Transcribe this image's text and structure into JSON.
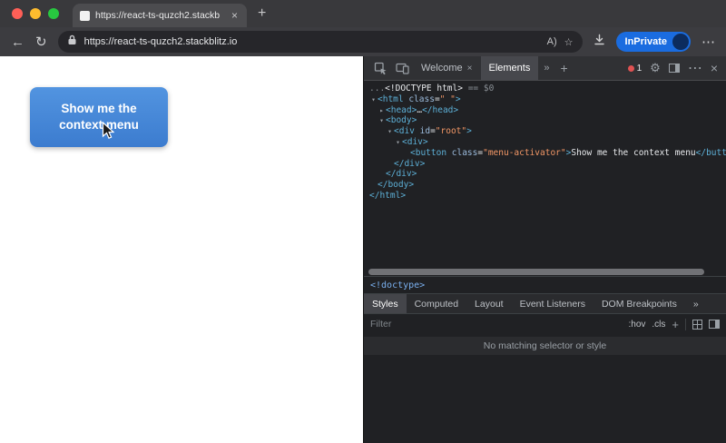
{
  "icons": {
    "back": "←",
    "refresh": "↻",
    "read_aloud": "A)",
    "favorites": "☆",
    "more": "⋯",
    "gear": "⚙",
    "close": "×",
    "chevrons": "»",
    "plus": "+"
  },
  "tabbar": {
    "tab_title": "https://react-ts-quzch2.stackb",
    "tab_close": "×",
    "new_tab": "+"
  },
  "navbar": {
    "url": "https://react-ts-quzch2.stackblitz.io",
    "inprivate": "InPrivate"
  },
  "page": {
    "button_label": "Show me the context menu"
  },
  "devtools": {
    "toolbar": {
      "tab_welcome": "Welcome",
      "tab_elements": "Elements",
      "issues_count": "1"
    },
    "tree": [
      {
        "i": 0,
        "tk": [
          {
            "c": "g",
            "v": "..."
          },
          {
            "c": "p",
            "v": "<!DOCTYPE html>"
          },
          {
            "c": "g",
            "v": " == $0"
          }
        ]
      },
      {
        "i": 0,
        "a": "d",
        "tk": [
          {
            "c": "t",
            "v": "<html"
          },
          {
            "c": "a",
            "v": " class"
          },
          {
            "c": "p",
            "v": "="
          },
          {
            "c": "s",
            "v": "\" \""
          },
          {
            "c": "t",
            "v": ">"
          }
        ]
      },
      {
        "i": 1,
        "a": "r",
        "tk": [
          {
            "c": "t",
            "v": "<head>"
          },
          {
            "c": "p",
            "v": "…"
          },
          {
            "c": "t",
            "v": "</head>"
          }
        ]
      },
      {
        "i": 1,
        "a": "d",
        "tk": [
          {
            "c": "t",
            "v": "<body>"
          }
        ]
      },
      {
        "i": 2,
        "a": "d",
        "tk": [
          {
            "c": "t",
            "v": "<div"
          },
          {
            "c": "a",
            "v": " id"
          },
          {
            "c": "p",
            "v": "="
          },
          {
            "c": "s",
            "v": "\"root\""
          },
          {
            "c": "t",
            "v": ">"
          }
        ]
      },
      {
        "i": 3,
        "a": "d",
        "tk": [
          {
            "c": "t",
            "v": "<div>"
          }
        ]
      },
      {
        "i": 4,
        "a": "s",
        "tk": [
          {
            "c": "t",
            "v": "<button"
          },
          {
            "c": "a",
            "v": " class"
          },
          {
            "c": "p",
            "v": "="
          },
          {
            "c": "s",
            "v": "\"menu-activator\""
          },
          {
            "c": "t",
            "v": ">"
          },
          {
            "c": "p",
            "v": "Show me the context menu"
          },
          {
            "c": "t",
            "v": "</button>"
          }
        ]
      },
      {
        "i": 3,
        "tk": [
          {
            "c": "t",
            "v": "</div>"
          }
        ]
      },
      {
        "i": 2,
        "tk": [
          {
            "c": "t",
            "v": "</div>"
          }
        ]
      },
      {
        "i": 1,
        "tk": [
          {
            "c": "t",
            "v": "</body>"
          }
        ]
      },
      {
        "i": 0,
        "tk": [
          {
            "c": "t",
            "v": "</html>"
          }
        ]
      }
    ],
    "breadcrumb": "<!doctype>",
    "styles_tabs": [
      "Styles",
      "Computed",
      "Layout",
      "Event Listeners",
      "DOM Breakpoints"
    ],
    "filter": {
      "placeholder": "Filter",
      "hov": ":hov",
      "cls": ".cls"
    },
    "empty_message": "No matching selector or style"
  }
}
